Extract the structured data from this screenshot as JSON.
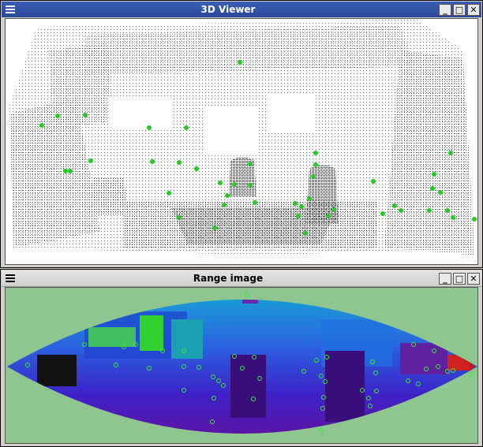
{
  "viewer": {
    "title": "3D Viewer",
    "controls": {
      "minimize": "_",
      "maximize": "□",
      "close": "✕"
    }
  },
  "range": {
    "title": "Range image",
    "controls": {
      "minimize": "_",
      "maximize": "□",
      "close": "✕"
    }
  },
  "colors": {
    "title_active": "#2c4a9a",
    "keypoint": "#22cc22",
    "range_bg": "#8fc68f"
  }
}
